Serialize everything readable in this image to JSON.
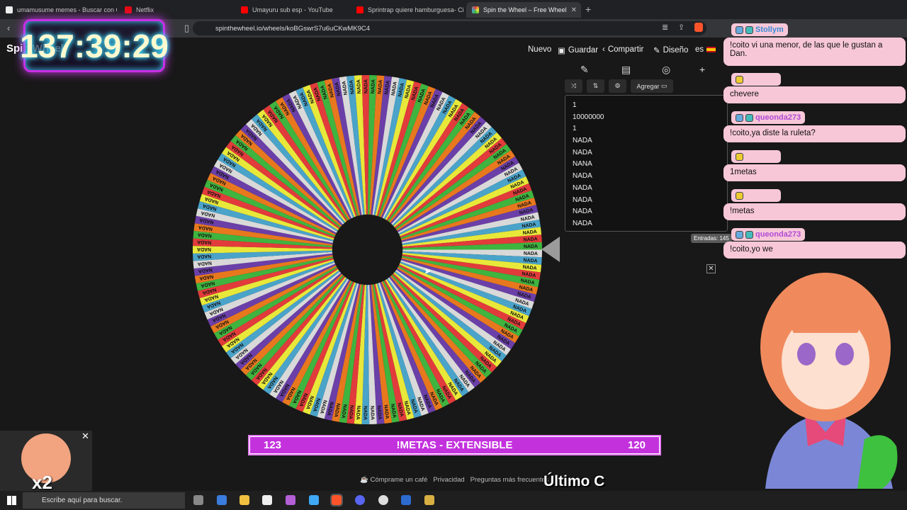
{
  "browser": {
    "tabs": [
      {
        "title": "umamusume memes - Buscar con Google",
        "active": false
      },
      {
        "title": "Netflix",
        "active": false
      },
      {
        "title": "Umayuru sub esp - YouTube",
        "active": false
      },
      {
        "title": "Sprintrap quiere hamburguesa- Circle",
        "active": false
      },
      {
        "title": "Spin the Wheel – Free Wheel",
        "active": true
      }
    ],
    "close_tab": "✕",
    "new_tab": "+",
    "url": "spinthewheel.io/wheels/koBGswrS7u6uCKwMK9C4"
  },
  "site": {
    "title": "Spin Wheel",
    "nav": {
      "nuevo": "Nuevo",
      "guardar": "Guardar",
      "compartir": "Compartir",
      "diseno": "Diseño",
      "lang": "es"
    },
    "add_label": "Agregar",
    "entries": [
      "1",
      "10000000",
      "1",
      "NADA",
      "NADA",
      "NANA",
      "NADA",
      "NADA",
      "NADA",
      "NADA",
      "NADA"
    ],
    "entradas": "Entradas: 145",
    "footer": {
      "cafe": "Cómprame un café",
      "privacidad": "Privacidad",
      "faq": "Preguntas más frecuentes"
    }
  },
  "wheel": {
    "label": "NADA",
    "colors": [
      "#d9d9d9",
      "#4aa3c9",
      "#e8e83a",
      "#e23b3b",
      "#3fb43f",
      "#e8781e",
      "#6b3fa8"
    ]
  },
  "stream": {
    "timer": "137:39:29",
    "metas": {
      "left": "123",
      "center": "!METAS - EXTENSIBLE",
      "right": "120"
    },
    "ultimo": "Último C",
    "webcam_label": "x2"
  },
  "chat": {
    "messages": [
      {
        "user": "Stollym",
        "text": "!coito vi una menor, de las que le gustan a Dan."
      },
      {
        "user": "",
        "text": "chevere"
      },
      {
        "user": "queonda273",
        "text": "!coito,ya diste la ruleta?"
      },
      {
        "user": "",
        "text": "1metas"
      },
      {
        "user": "",
        "text": "!metas"
      },
      {
        "user": "queonda273",
        "text": "!coito,yo we"
      }
    ]
  },
  "taskbar": {
    "search_placeholder": "Escribe aquí para buscar."
  }
}
